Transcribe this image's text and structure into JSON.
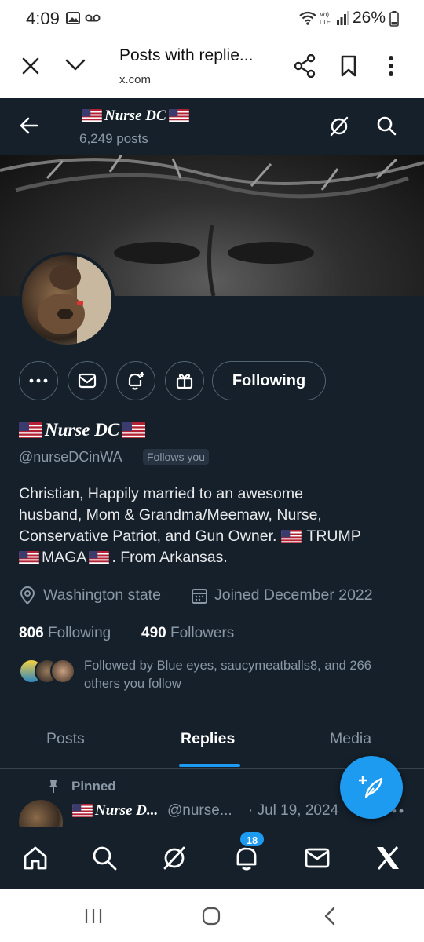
{
  "status_bar": {
    "time": "4:09",
    "battery": "26%",
    "network": "LTE"
  },
  "browser": {
    "title": "Posts with replie...",
    "url": "x.com"
  },
  "profile": {
    "name": "Nurse DC",
    "post_count": "6,249 posts",
    "handle": "@nurseDCinWA",
    "follows_you": "Follows you",
    "following_button": "Following",
    "bio_line1": "Christian, Happily married to an awesome",
    "bio_line2": "husband, Mom & Grandma/Meemaw, Nurse,",
    "bio_line3_a": "Conservative Patriot, and Gun Owner.",
    "bio_line3_b": "TRUMP",
    "bio_line4_a": "MAGA",
    "bio_line4_b": ". From Arkansas.",
    "location": "Washington state",
    "joined": "Joined December 2022",
    "following_count": "806",
    "following_label": "Following",
    "followers_count": "490",
    "followers_label": "Followers",
    "followed_by": "Followed by Blue eyes, saucymeatballs8, and 266 others you follow"
  },
  "tabs": [
    {
      "label": "Posts"
    },
    {
      "label": "Replies"
    },
    {
      "label": "Media"
    }
  ],
  "pinned_post": {
    "pinned_label": "Pinned",
    "author": "Nurse D...",
    "handle": "@nurse...",
    "date": "· Jul 19, 2024"
  },
  "bottom_nav": {
    "notification_badge": "18"
  },
  "colors": {
    "background": "#15202b",
    "accent": "#1d9bf0",
    "muted": "#8b98a5"
  }
}
